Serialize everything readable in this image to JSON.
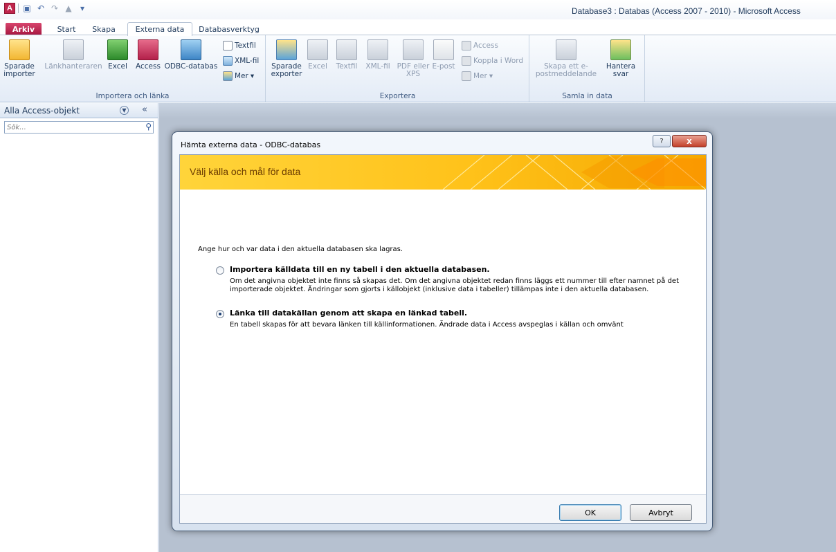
{
  "window": {
    "title": "Database3 : Databas (Access 2007 - 2010)  -  Microsoft Access"
  },
  "qat": {
    "app_icon": "A"
  },
  "tabs": {
    "arkiv": "Arkiv",
    "start": "Start",
    "skapa": "Skapa",
    "externa": "Externa data",
    "verktyg": "Databasverktyg"
  },
  "ribbon": {
    "import_group": {
      "label": "Importera och länka",
      "sparade_importer": "Sparade importer",
      "lankhanteraren": "Länkhanteraren",
      "excel": "Excel",
      "access": "Access",
      "odbc": "ODBC-databas",
      "textfil": "Textfil",
      "xmlfil": "XML-fil",
      "mer": "Mer"
    },
    "export_group": {
      "label": "Exportera",
      "sparade_exporter": "Sparade exporter",
      "excel": "Excel",
      "textfil": "Textfil",
      "xmlfil": "XML-fil",
      "pdf": "PDF eller XPS",
      "epost": "E-post",
      "access": "Access",
      "koppla": "Koppla i Word",
      "mer": "Mer"
    },
    "collect_group": {
      "label": "Samla in data",
      "skapa_epost": "Skapa ett e-postmeddelande",
      "hantera_svar": "Hantera svar"
    }
  },
  "navpane": {
    "title": "Alla Access-objekt",
    "search_placeholder": "Sök..."
  },
  "dialog": {
    "title": "Hämta externa data - ODBC-databas",
    "help": "?",
    "close": "x",
    "banner_title": "Välj källa och mål för data",
    "intro": "Ange hur och var data i den aktuella databasen ska lagras.",
    "option_import": {
      "label": "Importera källdata till en ny tabell i den aktuella databasen.",
      "desc": "Om det angivna objektet inte finns så skapas det. Om det angivna objektet redan finns läggs ett nummer till efter namnet på det importerade objektet. Ändringar som gjorts i källobjekt (inklusive data i tabeller) tillämpas inte i den aktuella databasen.",
      "checked": false
    },
    "option_link": {
      "label": "Länka till datakällan genom att skapa en länkad tabell.",
      "desc": "En tabell skapas för att bevara länken till källinformationen. Ändrade data i Access avspeglas i källan och omvänt",
      "checked": true
    },
    "ok": "OK",
    "cancel": "Avbryt"
  }
}
